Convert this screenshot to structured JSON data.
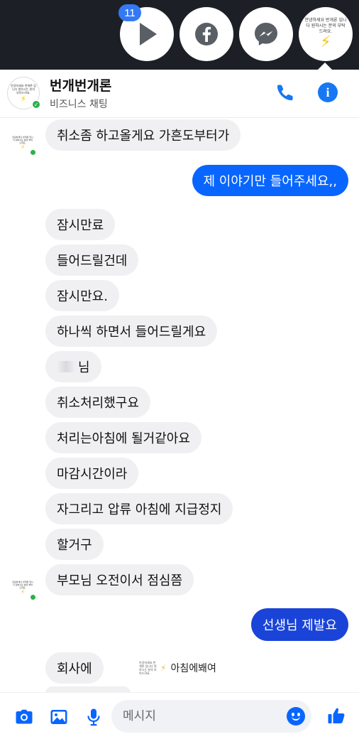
{
  "chat_heads": {
    "badge_count": "11",
    "brand_text": "안녕하세요 번개론 입니다 원하시는 분의 부탁드려요."
  },
  "header": {
    "name": "번개번개론",
    "subtitle": "비즈니스 채팅",
    "avatar_text": "안녕하세요 번개론 입니다 원하시는 분의 부탁드려요."
  },
  "messages": [
    {
      "side": "in",
      "text": "취소좀 하고올게요 가흔도부터가"
    },
    {
      "side": "out",
      "text": "제 이야기만 들어주세요,,"
    },
    {
      "side": "in",
      "text": "잠시만료"
    },
    {
      "side": "in",
      "text": "들어드릴건데"
    },
    {
      "side": "in",
      "text": "잠시만요."
    },
    {
      "side": "in",
      "text": "하나씩 하면서 들어드릴게요"
    },
    {
      "side": "in",
      "text": "님"
    },
    {
      "side": "in",
      "text": "취소처리했구요"
    },
    {
      "side": "in",
      "text": "처리는아침에 될거같아요"
    },
    {
      "side": "in",
      "text": "마감시간이라"
    },
    {
      "side": "in",
      "text": "자그리고 압류 아침에 지급정지"
    },
    {
      "side": "in",
      "text": "할거구"
    },
    {
      "side": "in",
      "text": "부모님 오전이서 점심쯤"
    },
    {
      "side": "out",
      "text": "선생님 제발요"
    },
    {
      "side": "in",
      "text": "회사에"
    }
  ],
  "notification_preview": "아침에봬여",
  "composer": {
    "placeholder": "메시지"
  },
  "colors": {
    "outgoing": "#0866ff",
    "incoming": "#f0f0f3",
    "accent": "#1877f2"
  },
  "icons": [
    "play-icon",
    "facebook-icon",
    "messenger-icon",
    "phone-icon",
    "info-icon",
    "camera-icon",
    "image-icon",
    "microphone-icon",
    "emoji-icon",
    "thumbs-up-icon"
  ]
}
